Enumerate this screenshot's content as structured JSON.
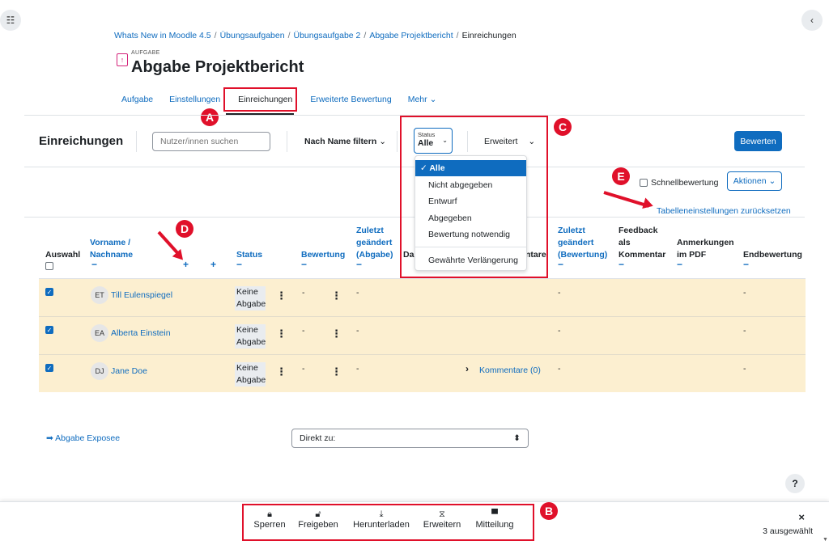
{
  "breadcrumb": [
    "Whats New in Moodle 4.5",
    "Übungsaufgaben",
    "Übungsaufgabe 2",
    "Abgabe Projektbericht",
    "Einreichungen"
  ],
  "activity": {
    "label": "AUFGABE",
    "title": "Abgabe Projektbericht"
  },
  "tabs": [
    "Aufgabe",
    "Einstellungen",
    "Einreichungen",
    "Erweiterte Bewertung",
    "Mehr"
  ],
  "toolbar": {
    "heading": "Einreichungen",
    "search_placeholder": "Nutzer/innen suchen",
    "name_filter": "Nach Name filtern",
    "status_label": "Status",
    "status_value": "Alle",
    "advanced": "Erweitert",
    "grade_button": "Bewerten"
  },
  "status_options": [
    "Alle",
    "Nicht abgegeben",
    "Entwurf",
    "Abgegeben",
    "Bewertung notwendig",
    "Gewährte Verlängerung"
  ],
  "options": {
    "quick_grading": "Schnellbewertung",
    "actions": "Aktionen",
    "reset_table": "Tabelleneinstellungen zurücksetzen"
  },
  "columns": {
    "select": "Auswahl",
    "name_1": "Vorname /",
    "name_2": "Nachname",
    "status": "Status",
    "grade": "Bewertung",
    "mod_sub_1": "Zuletzt",
    "mod_sub_2": "geändert",
    "mod_sub_3": "(Abgabe)",
    "dat": "Da",
    "comments_tail": "ntare",
    "mod_grade_1": "Zuletzt",
    "mod_grade_2": "geändert",
    "mod_grade_3": "(Bewertung)",
    "fb_1": "Feedback",
    "fb_2": "als",
    "fb_3": "Kommentar",
    "pdf_1": "Anmerkungen",
    "pdf_2": "im PDF",
    "final": "Endbewertung",
    "collapse": "−",
    "expand": "+"
  },
  "rows": [
    {
      "initials": "ET",
      "name": "Till Eulenspiegel",
      "status_1": "Keine",
      "status_2": "Abgabe",
      "grade": "-",
      "modified": "-",
      "mod_grade": "-",
      "final": "-",
      "comments": ""
    },
    {
      "initials": "EA",
      "name": "Alberta Einstein",
      "status_1": "Keine",
      "status_2": "Abgabe",
      "grade": "-",
      "modified": "-",
      "mod_grade": "-",
      "final": "-",
      "comments": ""
    },
    {
      "initials": "DJ",
      "name": "Jane Doe",
      "status_1": "Keine",
      "status_2": "Abgabe",
      "grade": "-",
      "modified": "-",
      "mod_grade": "-",
      "final": "-",
      "comments": "Kommentare (0)"
    }
  ],
  "navigation": {
    "prev_activity": "➡ Abgabe Exposee",
    "jump_placeholder": "Direkt zu:"
  },
  "help": "?",
  "footer": {
    "actions": [
      {
        "icon": "lock-icon",
        "label": "Sperren"
      },
      {
        "icon": "unlock-icon",
        "label": "Freigeben"
      },
      {
        "icon": "download-icon",
        "label": "Herunterladen"
      },
      {
        "icon": "hourglass-icon",
        "label": "Erweitern"
      },
      {
        "icon": "message-icon",
        "label": "Mitteilung"
      }
    ],
    "selected_count": "3 ausgewählt",
    "close": "×"
  },
  "markers": [
    "A",
    "B",
    "C",
    "D",
    "E"
  ],
  "colors": {
    "accent": "#0f6cbf",
    "annotation": "#e0102a",
    "row_selected": "#fcefd0"
  }
}
